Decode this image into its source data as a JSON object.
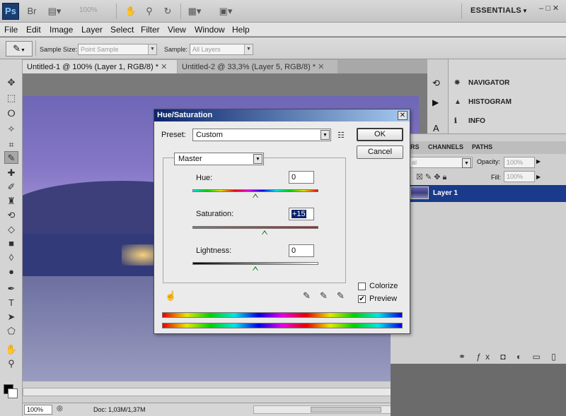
{
  "app": {
    "logo": "Ps",
    "zoom_display": "100%",
    "workspace": "ESSENTIALS",
    "window_controls": "– □ ✕"
  },
  "menu": [
    "File",
    "Edit",
    "Image",
    "Layer",
    "Select",
    "Filter",
    "View",
    "Window",
    "Help"
  ],
  "options_bar": {
    "sample_size_label": "Sample Size:",
    "sample_size_value": "Point Sample",
    "sample_label": "Sample:",
    "sample_value": "All Layers"
  },
  "doc_tabs": [
    {
      "label": "Untitled-1 @ 100% (Layer 1, RGB/8) *"
    },
    {
      "label": "Untitled-2 @ 33,3% (Layer 5, RGB/8) *"
    }
  ],
  "status": {
    "zoom": "100%",
    "doc": "Doc: 1,03M/1,37M"
  },
  "panels": {
    "nav": [
      "NAVIGATOR",
      "HISTOGRAM",
      "INFO"
    ],
    "layer_tabs": [
      "RS",
      "CHANNELS",
      "PATHS"
    ],
    "blend_mode": "al",
    "opacity_label": "Opacity:",
    "opacity_value": "100%",
    "fill_label": "Fill:",
    "fill_value": "100%",
    "layer_name": "Layer 1"
  },
  "dialog": {
    "title": "Hue/Saturation",
    "close": "✕",
    "preset_label": "Preset:",
    "preset_value": "Custom",
    "ok": "OK",
    "cancel": "Cancel",
    "edit_channel": "Master",
    "hue_label": "Hue:",
    "hue_value": "0",
    "saturation_label": "Saturation:",
    "saturation_value": "+15",
    "lightness_label": "Lightness:",
    "lightness_value": "0",
    "hue_level": 0.5,
    "saturation_level": 0.575,
    "lightness_level": 0.5,
    "colorize_label": "Colorize",
    "colorize_checked": false,
    "preview_label": "Preview",
    "preview_checked": true,
    "preview_check_glyph": "✔"
  }
}
